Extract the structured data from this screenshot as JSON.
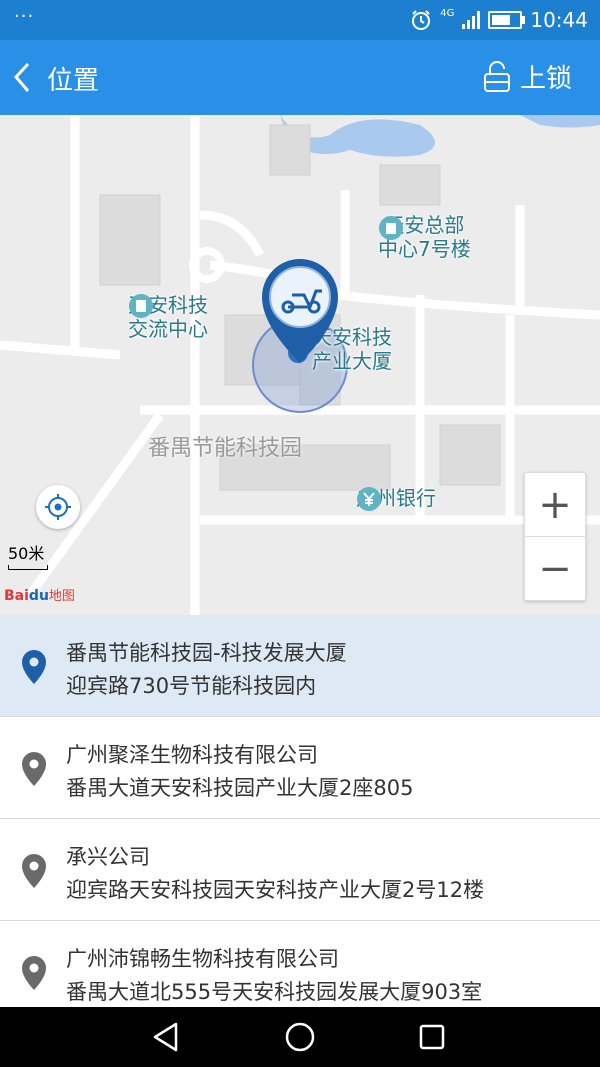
{
  "status_bar": {
    "notification": "···",
    "network": "4G",
    "time": "10:44",
    "battery_level": 0.7
  },
  "header": {
    "title": "位置",
    "lock_label": "上锁"
  },
  "map": {
    "poi_1": {
      "line1": "天安总部",
      "line2": "中心7号楼"
    },
    "poi_2": {
      "line1": "天安科技",
      "line2": "交流中心"
    },
    "poi_3": {
      "line1": "天安科技",
      "line2": "产业大厦"
    },
    "area_label": "番禺节能科技园",
    "bank_label": "广州银行",
    "scale_label": "50米",
    "logo_text": {
      "bai": "Bai",
      "du": "du",
      "map": "地图"
    },
    "zoom_in": "+",
    "zoom_out": "−"
  },
  "locations": [
    {
      "name": "番禺节能科技园-科技发展大厦",
      "address": "迎宾路730号节能科技园内",
      "selected": true
    },
    {
      "name": "广州聚泽生物科技有限公司",
      "address": "番禺大道天安科技园产业大厦2座805",
      "selected": false
    },
    {
      "name": "承兴公司",
      "address": "迎宾路天安科技园天安科技产业大厦2号12楼",
      "selected": false
    },
    {
      "name": "广州沛锦畅生物科技有限公司",
      "address": "番禺大道北555号天安科技园发展大厦903室",
      "selected": false
    }
  ],
  "colors": {
    "status_bar": "#1c7fd0",
    "header": "#2a8fe6",
    "selected_row": "#dde9f4",
    "pin_selected": "#1f5fa8",
    "pin_default": "#6a6a6a"
  }
}
